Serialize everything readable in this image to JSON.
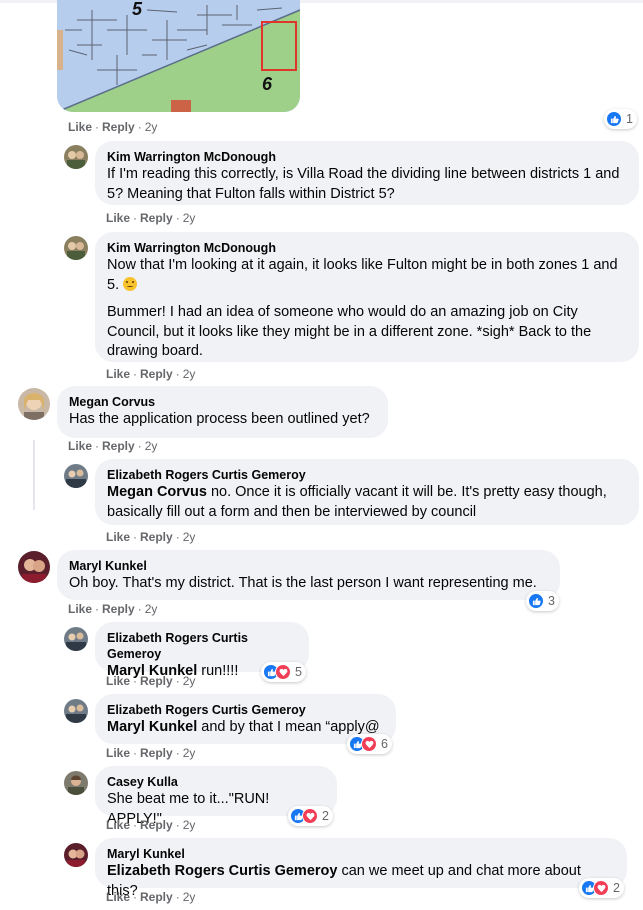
{
  "map": {
    "labels": [
      "5",
      "6"
    ]
  },
  "actions": {
    "like": "Like",
    "reply": "Reply",
    "sep": "·"
  },
  "post_meta": {
    "time": "2y",
    "reactions": "1"
  },
  "comments": [
    {
      "name": "Kim Warrington McDonough",
      "paragraphs": [
        "If I'm reading this correctly, is Villa Road the dividing line between districts 1 and 5? Meaning that Fulton falls within District 5?"
      ],
      "time": "2y"
    },
    {
      "name": "Kim Warrington McDonough",
      "paragraphs": [
        "Now that I'm looking at it again, it looks like Fulton might be in both zones 1 and 5.",
        "Bummer! I had an idea of someone who would do an amazing job on City Council, but it looks like they might be in a different zone. *sigh* Back to the drawing board."
      ],
      "time": "2y"
    },
    {
      "name": "Megan Corvus",
      "paragraphs": [
        "Has the application process been outlined yet?"
      ],
      "time": "2y"
    },
    {
      "name": "Elizabeth Rogers Curtis Gemeroy",
      "mention": "Megan Corvus",
      "paragraphs": [
        " no. Once it is officially vacant it will be. It's pretty easy though, basically fill out a form and then be interviewed by council"
      ],
      "time": "2y"
    },
    {
      "name": "Maryl Kunkel",
      "paragraphs": [
        "Oh boy. That's my district. That is the last person I want representing me."
      ],
      "time": "2y",
      "reactions": "3"
    },
    {
      "name": "Elizabeth Rogers Curtis Gemeroy",
      "mention": "Maryl Kunkel",
      "paragraphs": [
        " run!!!!"
      ],
      "time": "2y",
      "reactions": "5"
    },
    {
      "name": "Elizabeth Rogers Curtis Gemeroy",
      "mention": "Maryl Kunkel",
      "paragraphs": [
        " and by that I mean “apply@"
      ],
      "time": "2y",
      "reactions": "6"
    },
    {
      "name": "Casey Kulla",
      "paragraphs": [
        "She beat me to it...\"RUN! APPLY!\""
      ],
      "time": "2y",
      "reactions": "2"
    },
    {
      "name": "Maryl Kunkel",
      "mention": "Elizabeth Rogers Curtis Gemeroy",
      "paragraphs": [
        " can we meet up and chat more about this?"
      ],
      "time": "2y",
      "reactions": "2"
    }
  ],
  "colors": {
    "like": "#1877f2",
    "love": "#f33e58",
    "bubble": "#f0f2f5",
    "meta": "#65676b"
  }
}
